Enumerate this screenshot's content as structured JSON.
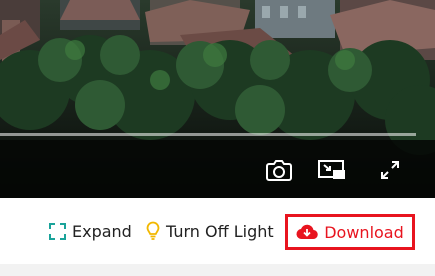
{
  "player": {
    "icons": {
      "screenshot": "camera-icon",
      "pip": "picture-in-picture-icon",
      "fullscreen": "fullscreen-icon"
    }
  },
  "toolbar": {
    "expand_label": "Expand",
    "turn_off_light_label": "Turn Off Light",
    "download_label": "Download",
    "icons": {
      "expand": "expand-icon",
      "light": "lightbulb-icon",
      "download": "cloud-download-icon"
    }
  },
  "colors": {
    "expand_accent": "#1aa39a",
    "bulb": "#f2b800",
    "download_red": "#e8141f"
  }
}
